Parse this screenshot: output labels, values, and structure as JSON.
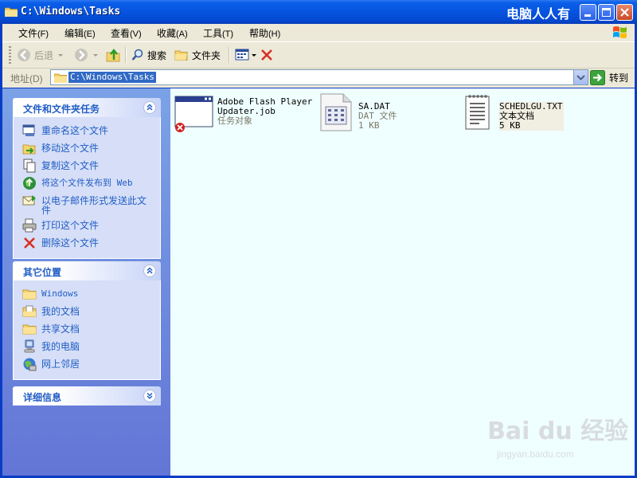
{
  "window": {
    "title": "C:\\Windows\\Tasks",
    "watermark": "电脑人人有"
  },
  "menu": [
    {
      "label": "文件",
      "acc": "(F)"
    },
    {
      "label": "编辑",
      "acc": "(E)"
    },
    {
      "label": "查看",
      "acc": "(V)"
    },
    {
      "label": "收藏",
      "acc": "(A)"
    },
    {
      "label": "工具",
      "acc": "(T)"
    },
    {
      "label": "帮助",
      "acc": "(H)"
    }
  ],
  "toolbar": {
    "back_label": "后退",
    "search_label": "搜索",
    "folders_label": "文件夹"
  },
  "address": {
    "label": "地址",
    "acc": "(D)",
    "value": "C:\\Windows\\Tasks",
    "go_label": "转到"
  },
  "panels": {
    "file_tasks": {
      "title": "文件和文件夹任务",
      "items": [
        {
          "label": "重命名这个文件",
          "icon": "rename-icon"
        },
        {
          "label": "移动这个文件",
          "icon": "move-icon"
        },
        {
          "label": "复制这个文件",
          "icon": "copy-icon"
        },
        {
          "label": "将这个文件发布到 Web",
          "icon": "publish-web-icon"
        },
        {
          "label": "以电子邮件形式发送此文件",
          "icon": "email-icon"
        },
        {
          "label": "打印这个文件",
          "icon": "printer-icon"
        },
        {
          "label": "删除这个文件",
          "icon": "delete-icon"
        }
      ]
    },
    "other_places": {
      "title": "其它位置",
      "items": [
        {
          "label": "Windows",
          "icon": "folder-icon"
        },
        {
          "label": "我的文档",
          "icon": "my-documents-icon"
        },
        {
          "label": "共享文档",
          "icon": "shared-folder-icon"
        },
        {
          "label": "我的电脑",
          "icon": "my-computer-icon"
        },
        {
          "label": "网上邻居",
          "icon": "network-icon"
        }
      ]
    },
    "details": {
      "title": "详细信息"
    }
  },
  "files": [
    {
      "name_line1": "Adobe Flash Player",
      "name_line2": "Updater.job",
      "type": "任务对象",
      "size": "",
      "icon": "scheduled-task-icon"
    },
    {
      "name_line1": "SA.DAT",
      "name_line2": "",
      "type": "DAT 文件",
      "size": "1 KB",
      "icon": "dat-file-icon"
    },
    {
      "name_line1": "SCHEDLGU.TXT",
      "name_line2": "",
      "type": "文本文档",
      "size": "5 KB",
      "icon": "text-file-icon"
    }
  ],
  "watermark": {
    "brand": "Bai du 经验",
    "url": "jingyan.baidu.com"
  },
  "colors": {
    "titlebar": "#0654E0",
    "task_link": "#215DC6",
    "content_bg": "#EFFFFF",
    "selection": "#316AC5"
  }
}
